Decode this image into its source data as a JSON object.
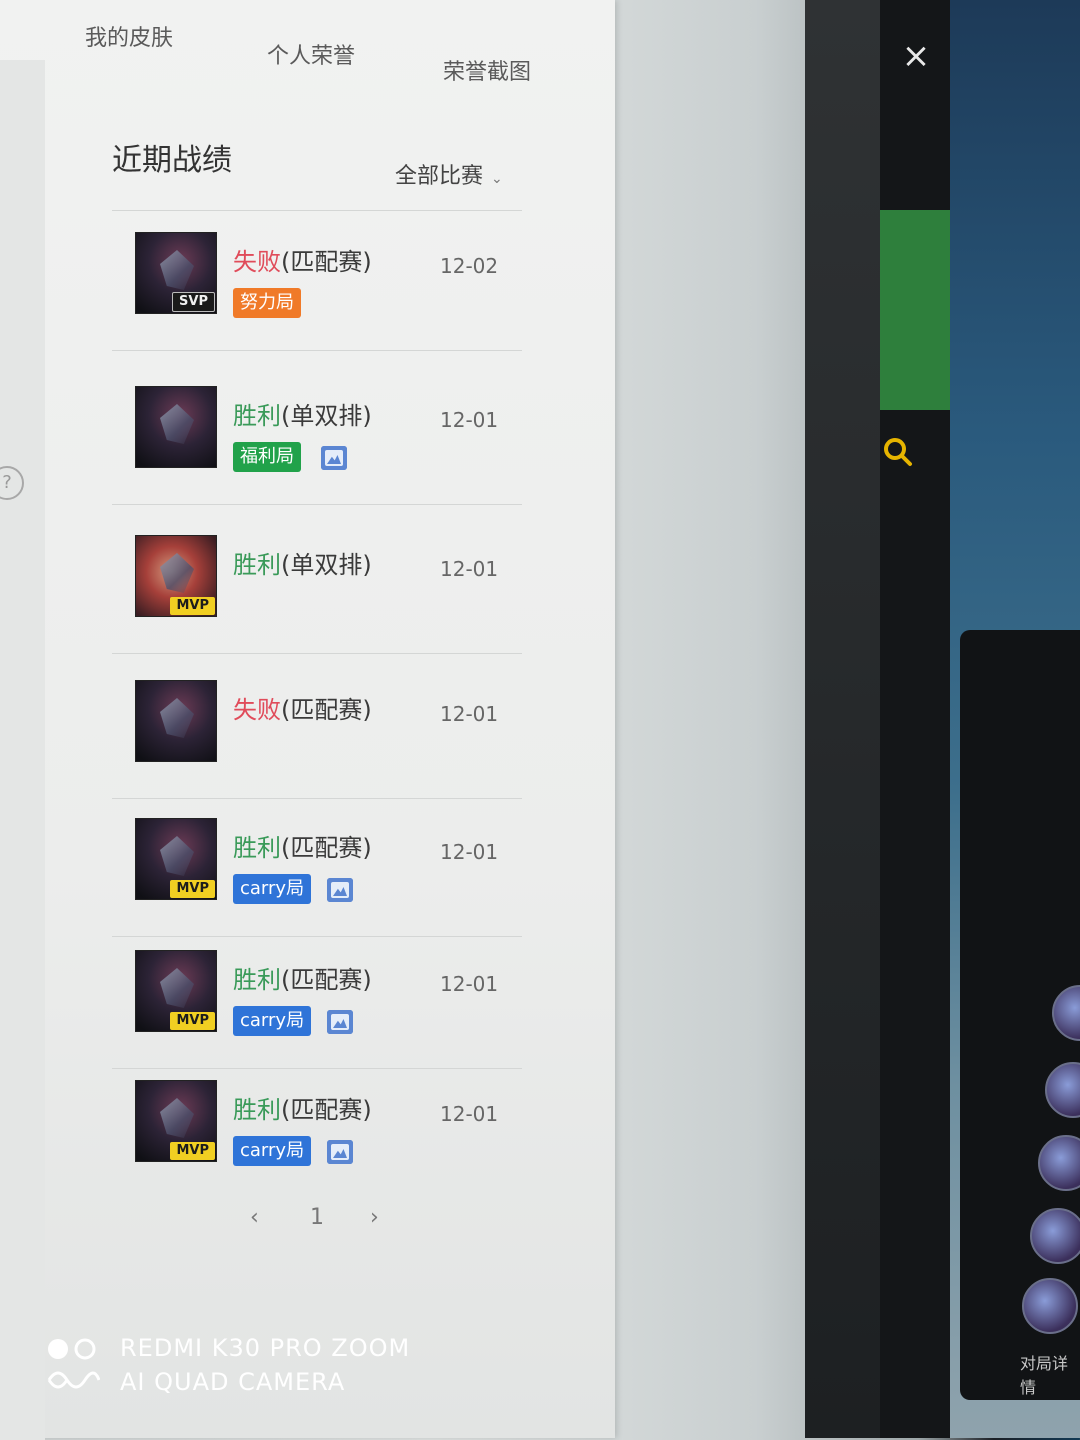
{
  "tabs": [
    "我的皮肤",
    "个人荣誉",
    "荣誉截图"
  ],
  "section_title": "近期战绩",
  "filter_label": "全部比赛",
  "matches": [
    {
      "result": "失败",
      "mode": "(匹配赛)",
      "date": "12-02",
      "badge": "SVP",
      "tag": "努力局",
      "tag_color": "#f07a28",
      "has_pic": false
    },
    {
      "result": "胜利",
      "mode": "(单双排)",
      "date": "12-01",
      "badge": "",
      "tag": "福利局",
      "tag_color": "#21a24a",
      "has_pic": true
    },
    {
      "result": "胜利",
      "mode": "(单双排)",
      "date": "12-01",
      "badge": "MVP",
      "tag": "",
      "tag_color": "",
      "has_pic": false
    },
    {
      "result": "失败",
      "mode": "(匹配赛)",
      "date": "12-01",
      "badge": "",
      "tag": "",
      "tag_color": "",
      "has_pic": false
    },
    {
      "result": "胜利",
      "mode": "(匹配赛)",
      "date": "12-01",
      "badge": "MVP",
      "tag": "carry局",
      "tag_color": "#2f74d8",
      "has_pic": true
    },
    {
      "result": "胜利",
      "mode": "(匹配赛)",
      "date": "12-01",
      "badge": "MVP",
      "tag": "carry局",
      "tag_color": "#2f74d8",
      "has_pic": true
    },
    {
      "result": "胜利",
      "mode": "(匹配赛)",
      "date": "12-01",
      "badge": "MVP",
      "tag": "carry局",
      "tag_color": "#2f74d8",
      "has_pic": true
    }
  ],
  "pagination": {
    "prev": "‹",
    "page": "1",
    "next": "›"
  },
  "side_panel": {
    "close": "×",
    "link": "对局详情"
  },
  "camera_watermark": {
    "line1": "REDMI K30 PRO ZOOM",
    "line2": "AI QUAD CAMERA"
  },
  "colors": {
    "win": "#3a9a59",
    "lose": "#e04b5a",
    "mvp": "#f1cf22"
  }
}
